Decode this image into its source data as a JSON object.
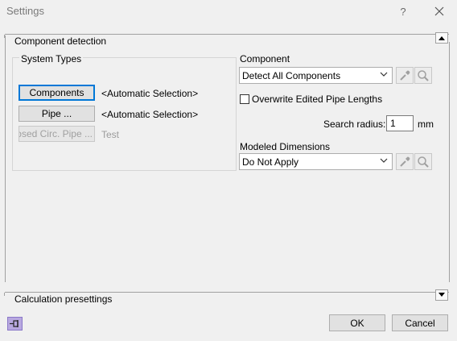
{
  "window": {
    "title": "Settings",
    "help_label": "?"
  },
  "sections": {
    "component_detection": "Component detection",
    "calculation_presettings": "Calculation presettings"
  },
  "system_types": {
    "legend": "System Types",
    "rows": [
      {
        "button": "Components",
        "value": "<Automatic Selection>",
        "enabled": true
      },
      {
        "button": "Pipe ...",
        "value": "<Automatic Selection>",
        "enabled": true
      },
      {
        "button": "Closed Circ. Pipe ...",
        "value": "Test",
        "enabled": false
      }
    ]
  },
  "component": {
    "label": "Component",
    "selected": "Detect All Components",
    "overwrite_label": "Overwrite Edited Pipe Lengths",
    "overwrite_checked": false,
    "search_radius_label": "Search radius:",
    "search_radius_value": "1",
    "search_radius_unit": "mm"
  },
  "modeled_dimensions": {
    "label": "Modeled Dimensions",
    "selected": "Do Not Apply"
  },
  "footer": {
    "ok": "OK",
    "cancel": "Cancel"
  },
  "icons": [
    "close-icon",
    "help-icon",
    "eyedropper-icon",
    "magnifier-icon",
    "pin-icon",
    "chevron-down-icon",
    "collapse-up-icon"
  ],
  "colors": {
    "focus": "#0078d7",
    "background": "#f0f0f0",
    "pin_button": "#b8a8e0"
  }
}
